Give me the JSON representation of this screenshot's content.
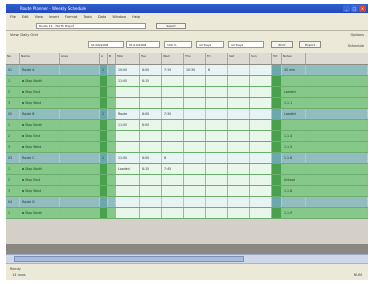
{
  "window": {
    "title": "Route Planner - Weekly Schedule"
  },
  "menu": [
    "File",
    "Edit",
    "View",
    "Insert",
    "Format",
    "Tools",
    "Data",
    "Window",
    "Help"
  ],
  "toolbar1": {
    "route_field": "Route 12 - North Depot",
    "go_label": "Select"
  },
  "toolbar2": {
    "view_label": "View: Daily Grid",
    "right_top": "Options",
    "right_mid": "Schedule",
    "date_from": "01/04/2008",
    "date_to": "01/10/2008",
    "zoom": "100 %",
    "range": "All Days",
    "print_label": "Print",
    "export_label": "Export"
  },
  "columns": [
    "No.",
    "Name",
    "Area",
    "A",
    "B",
    "Mon",
    "Tue",
    "Wed",
    "Thu",
    "Fri",
    "Sat",
    "Sun",
    "Tot",
    "Notes"
  ],
  "rows": [
    {
      "kind": "group",
      "no": "01",
      "name": "Route A",
      "area": "",
      "a": "1",
      "mon": "10:00",
      "tue": "8:00",
      "wed": "7:15",
      "thu": "10:30",
      "fri": "8",
      "sat": "",
      "sun": "",
      "tot": "",
      "notes": "45 min"
    },
    {
      "kind": "detail",
      "no": "1",
      "name": "Stop North",
      "area": "",
      "a": "",
      "mon": "11:00",
      "tue": "8:15",
      "wed": "",
      "thu": "",
      "fri": "",
      "sat": "",
      "sun": "",
      "tot": "",
      "notes": ""
    },
    {
      "kind": "detail",
      "no": "2",
      "name": "Stop East",
      "area": "",
      "a": "",
      "mon": "",
      "tue": "",
      "wed": "",
      "thu": "",
      "fri": "",
      "sat": "",
      "sun": "",
      "tot": "",
      "notes": "Loaded"
    },
    {
      "kind": "detail",
      "no": "3",
      "name": "Stop West",
      "area": "",
      "a": "",
      "mon": "",
      "tue": "",
      "wed": "",
      "thu": "",
      "fri": "",
      "sat": "",
      "sun": "",
      "tot": "",
      "notes": "1.1.1"
    },
    {
      "kind": "group",
      "no": "02",
      "name": "Route B",
      "area": "",
      "a": "1",
      "mon": "Route",
      "tue": "8:00",
      "wed": "7:30",
      "thu": "",
      "fri": "",
      "sat": "",
      "sun": "",
      "tot": "",
      "notes": "Loaded"
    },
    {
      "kind": "detail",
      "no": "1",
      "name": "Stop North",
      "area": "",
      "a": "",
      "mon": "11:00",
      "tue": "8:00",
      "wed": "",
      "thu": "",
      "fri": "",
      "sat": "",
      "sun": "",
      "tot": "",
      "notes": ""
    },
    {
      "kind": "detail",
      "no": "2",
      "name": "Stop East",
      "area": "",
      "a": "",
      "mon": "",
      "tue": "",
      "wed": "",
      "thu": "",
      "fri": "",
      "sat": "",
      "sun": "",
      "tot": "",
      "notes": "1.1.4"
    },
    {
      "kind": "detail",
      "no": "3",
      "name": "Stop West",
      "area": "",
      "a": "",
      "mon": "",
      "tue": "",
      "wed": "",
      "thu": "",
      "fri": "",
      "sat": "",
      "sun": "",
      "tot": "",
      "notes": "1.1.5"
    },
    {
      "kind": "group",
      "no": "03",
      "name": "Route C",
      "area": "",
      "a": "1",
      "mon": "11:00",
      "tue": "8:00",
      "wed": "8",
      "thu": "",
      "fri": "",
      "sat": "",
      "sun": "",
      "tot": "",
      "notes": "1.1.6"
    },
    {
      "kind": "detail",
      "no": "1",
      "name": "Stop North",
      "area": "",
      "a": "",
      "mon": "Loaded",
      "tue": "8:15",
      "wed": "7:45",
      "thu": "",
      "fri": "",
      "sat": "",
      "sun": "",
      "tot": "",
      "notes": ""
    },
    {
      "kind": "detail",
      "no": "2",
      "name": "Stop East",
      "area": "",
      "a": "",
      "mon": "",
      "tue": "",
      "wed": "",
      "thu": "",
      "fri": "",
      "sat": "",
      "sun": "",
      "tot": "",
      "notes": "Unload"
    },
    {
      "kind": "detail",
      "no": "3",
      "name": "Stop West",
      "area": "",
      "a": "",
      "mon": "",
      "tue": "",
      "wed": "",
      "thu": "",
      "fri": "",
      "sat": "",
      "sun": "",
      "tot": "",
      "notes": "1.1.8"
    },
    {
      "kind": "group",
      "no": "04",
      "name": "Route D",
      "area": "",
      "a": "",
      "mon": "",
      "tue": "",
      "wed": "",
      "thu": "",
      "fri": "",
      "sat": "",
      "sun": "",
      "tot": "",
      "notes": ""
    },
    {
      "kind": "detail",
      "no": "1",
      "name": "Stop North",
      "area": "",
      "a": "",
      "mon": "",
      "tue": "",
      "wed": "",
      "thu": "",
      "fri": "",
      "sat": "",
      "sun": "",
      "tot": "",
      "notes": "1.1.9"
    }
  ],
  "status": {
    "left": "Ready",
    "line2": "14 rows",
    "right": "NUM"
  },
  "colors": {
    "group_row": "#91bdbf",
    "detail_row": "#86c78a",
    "title_bar": "#2349b8"
  }
}
